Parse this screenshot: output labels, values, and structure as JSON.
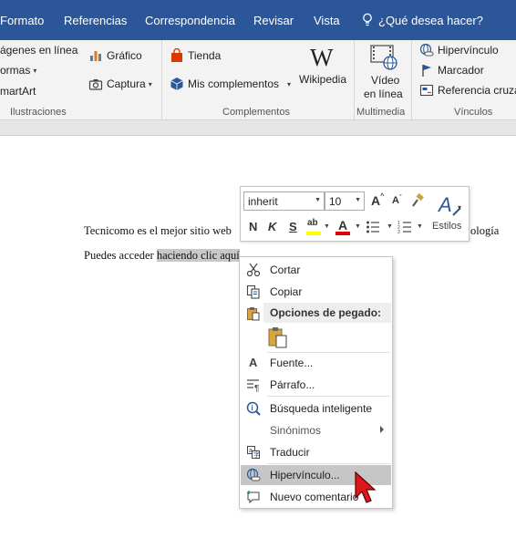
{
  "tabs": [
    {
      "label": "Formato"
    },
    {
      "label": "Referencias"
    },
    {
      "label": "Correspondencia"
    },
    {
      "label": "Revisar"
    },
    {
      "label": "Vista"
    }
  ],
  "tell_me": {
    "placeholder": "¿Qué desea hacer?",
    "icon": "lightbulb-icon"
  },
  "ribbon": {
    "illustrations": {
      "online_images": "ágenes en línea",
      "shapes": "ormas",
      "smartart": "martArt",
      "chart": "Gráfico",
      "screenshot": "Captura",
      "label": "Ilustraciones"
    },
    "addins": {
      "store": "Tienda",
      "my_addins": "Mis complementos",
      "wikipedia": "Wikipedia",
      "label": "Complementos"
    },
    "media": {
      "online_video_line1": "Vídeo",
      "online_video_line2": "en línea",
      "label": "Multimedia"
    },
    "links": {
      "hyperlink": "Hipervínculo",
      "bookmark": "Marcador",
      "cross_reference": "Referencia cruzad",
      "label": "Vínculos"
    }
  },
  "document": {
    "line1_start": "Tecnicomo es el mejor sitio web",
    "line1_end": "ología",
    "line2_prefix": "Puedes acceder ",
    "line2_selected": "haciendo clic aquí"
  },
  "mini_toolbar": {
    "font": "inherit",
    "size": "10",
    "styles_label": "Estilos",
    "colors": {
      "highlight": "#ffff00",
      "font_color": "#e00000"
    }
  },
  "context_menu": {
    "cut": "Cortar",
    "copy": "Copiar",
    "paste_options": "Opciones de pegado:",
    "font": "Fuente...",
    "paragraph": "Párrafo...",
    "smart_lookup": "Búsqueda inteligente",
    "synonyms": "Sinónimos",
    "translate": "Traducir",
    "hyperlink": "Hipervínculo...",
    "new_comment": "Nuevo comentario"
  },
  "colors": {
    "tab_bar": "#2b579a",
    "ribbon": "#f3f3f3",
    "menu_highlight": "#c6c6c6",
    "cursor": "#e0161b"
  }
}
